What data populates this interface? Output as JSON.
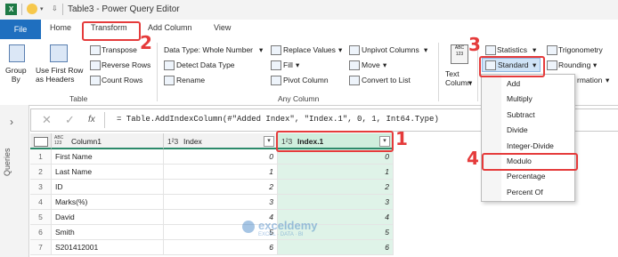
{
  "title_bar": {
    "title": "Table3 - Power Query Editor"
  },
  "tabs": [
    "File",
    "Home",
    "Transform",
    "Add Column",
    "View"
  ],
  "ribbon": {
    "table_group": {
      "group_by": "Group\nBy",
      "use_first_row": "Use First Row\nas Headers",
      "transpose": "Transpose",
      "reverse_rows": "Reverse Rows",
      "count_rows": "Count Rows",
      "label": "Table"
    },
    "any_column_group": {
      "data_type": "Data Type: Whole Number",
      "detect_data_type": "Detect Data Type",
      "rename": "Rename",
      "replace_values": "Replace Values",
      "fill": "Fill",
      "pivot_column": "Pivot Column",
      "unpivot_columns": "Unpivot Columns",
      "move": "Move",
      "convert_to_list": "Convert to List",
      "label": "Any Column"
    },
    "text_column": "Text\nColumn",
    "statistics": "Statistics",
    "standard": "Standard",
    "trigonometry": "Trigonometry",
    "rounding": "Rounding",
    "information_partial": "rmation"
  },
  "menu": {
    "items": [
      "Add",
      "Multiply",
      "Subtract",
      "Divide",
      "Integer-Divide",
      "Modulo",
      "Percentage",
      "Percent Of"
    ]
  },
  "formula_bar": {
    "fx": "fx",
    "formula": "= Table.AddIndexColumn(#\"Added Index\", \"Index.1\", 0, 1, Int64.Type)"
  },
  "left_pane": {
    "label": "Queries"
  },
  "grid": {
    "headers": [
      {
        "type": "ABC\n123",
        "name": "Column1"
      },
      {
        "type": "1²3",
        "name": "Index"
      },
      {
        "type": "1²3",
        "name": "Index.1"
      }
    ],
    "rows": [
      {
        "n": "1",
        "c1": "First Name",
        "idx": "0",
        "idx1": "0"
      },
      {
        "n": "2",
        "c1": "Last Name",
        "idx": "1",
        "idx1": "1"
      },
      {
        "n": "3",
        "c1": "ID",
        "idx": "2",
        "idx1": "2"
      },
      {
        "n": "4",
        "c1": "Marks(%)",
        "idx": "3",
        "idx1": "3"
      },
      {
        "n": "5",
        "c1": "David",
        "idx": "4",
        "idx1": "4"
      },
      {
        "n": "6",
        "c1": "Smith",
        "idx": "5",
        "idx1": "5"
      },
      {
        "n": "7",
        "c1": "S201412001",
        "idx": "6",
        "idx1": "6"
      }
    ]
  },
  "watermark": {
    "name": "exceldemy",
    "tag": "EXCEL · DATA · BI"
  },
  "callouts": [
    "1",
    "2",
    "3",
    "4"
  ],
  "colors": {
    "file_tab": "#1f6fbf",
    "highlight": "#e53b3b",
    "selected_column": "#dff3e8"
  }
}
